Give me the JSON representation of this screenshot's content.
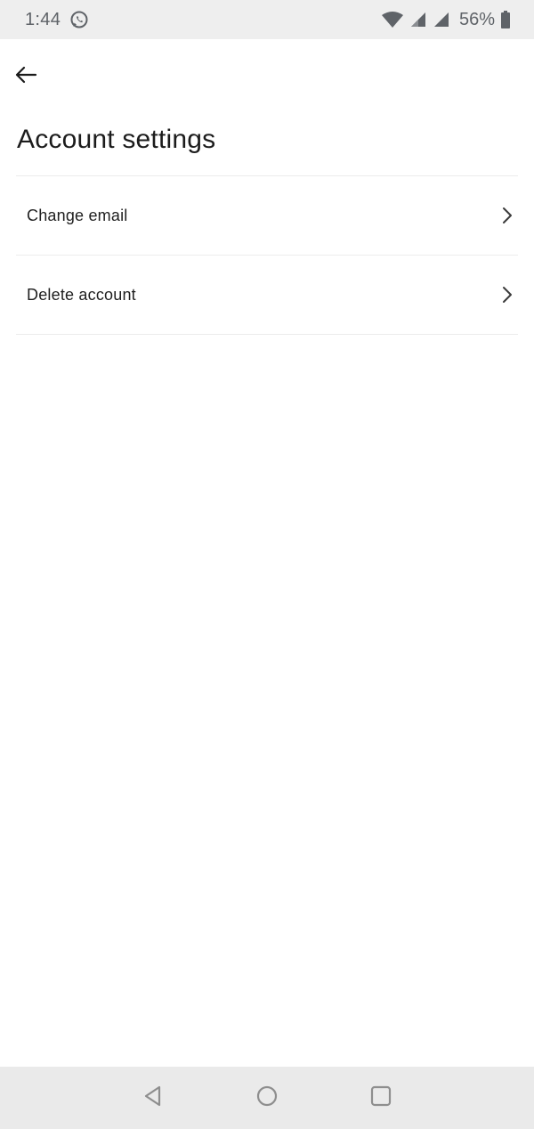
{
  "status_bar": {
    "time": "1:44",
    "battery": "56%",
    "icons": [
      "whatsapp-icon",
      "wifi-icon",
      "signal-icon",
      "signal-icon",
      "battery-icon"
    ],
    "color": "#5f6368",
    "background": "#eeeeee"
  },
  "app_bar": {
    "back_icon": "back-arrow-icon"
  },
  "page": {
    "title": "Account settings"
  },
  "settings": {
    "items": [
      {
        "label": "Change email",
        "icon": "chevron-right-icon"
      },
      {
        "label": "Delete account",
        "icon": "chevron-right-icon"
      }
    ]
  },
  "nav_bar": {
    "buttons": [
      "back-triangle-icon",
      "home-circle-icon",
      "recents-square-icon"
    ],
    "background": "#eaeaea"
  }
}
